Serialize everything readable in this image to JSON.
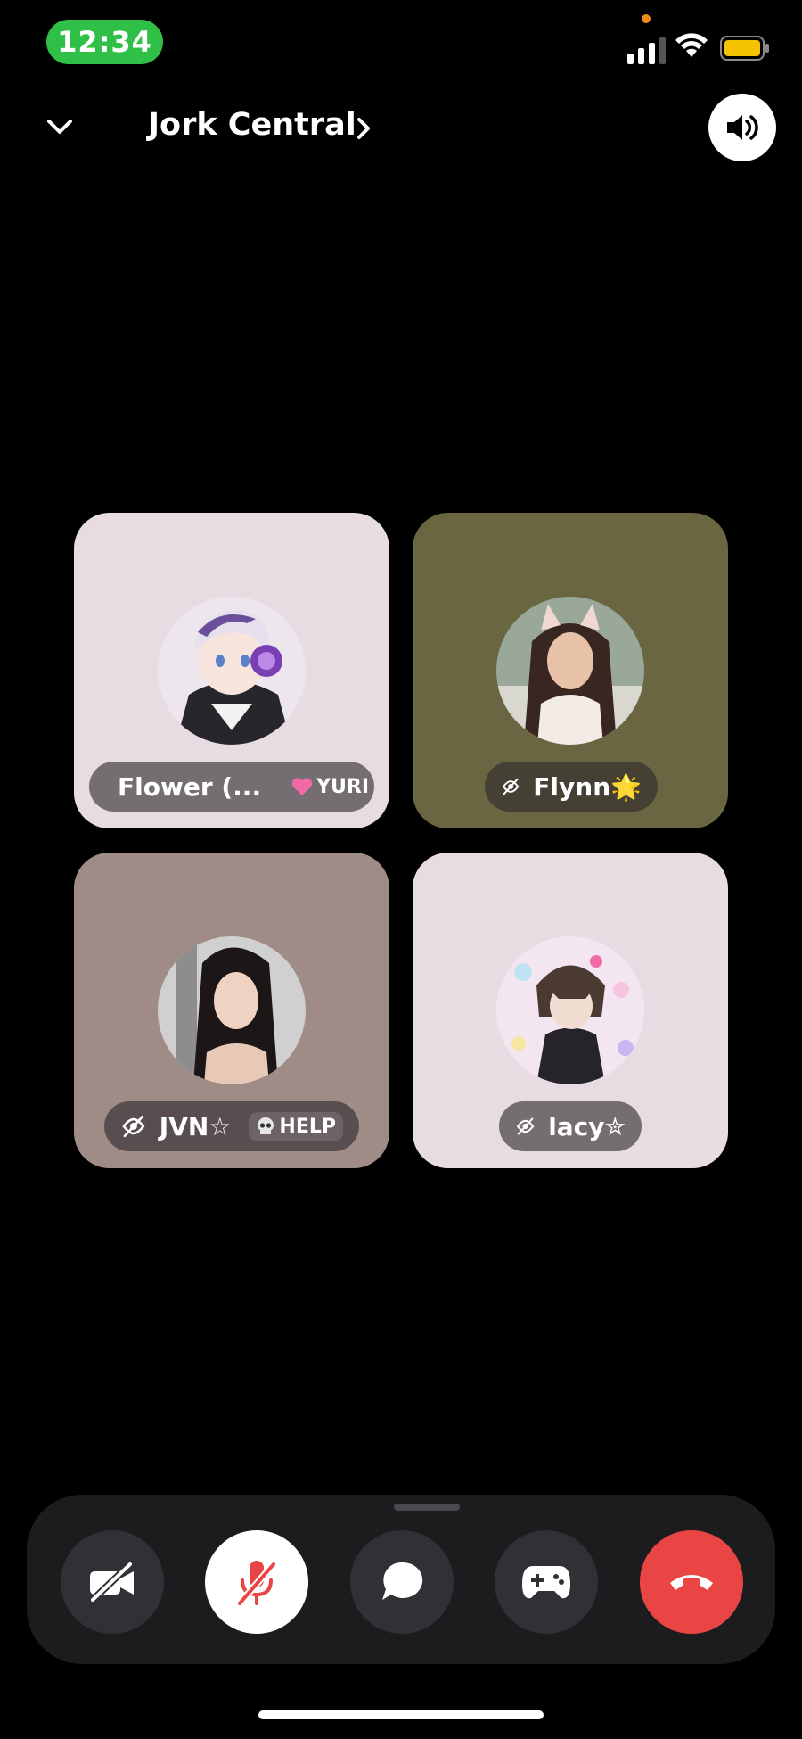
{
  "status_bar": {
    "time": "12:34"
  },
  "header": {
    "channel_name": "Jork Central"
  },
  "participants": [
    {
      "name": "Flower (...",
      "tag": "YURI",
      "tag_icon": "pink-heart-icon",
      "tile_color": "#e8dce3"
    },
    {
      "name": "Flynn",
      "name_emoji": "🌟",
      "tile_color": "#6a6641"
    },
    {
      "name": "JVN☆",
      "tag": "HELP",
      "tag_icon": "skull-icon",
      "tile_color": "#a08c86"
    },
    {
      "name": "lacy",
      "name_emoji": "✮",
      "tile_color": "#e8dce3"
    }
  ],
  "controls": {
    "end_call_color": "#e94545"
  }
}
